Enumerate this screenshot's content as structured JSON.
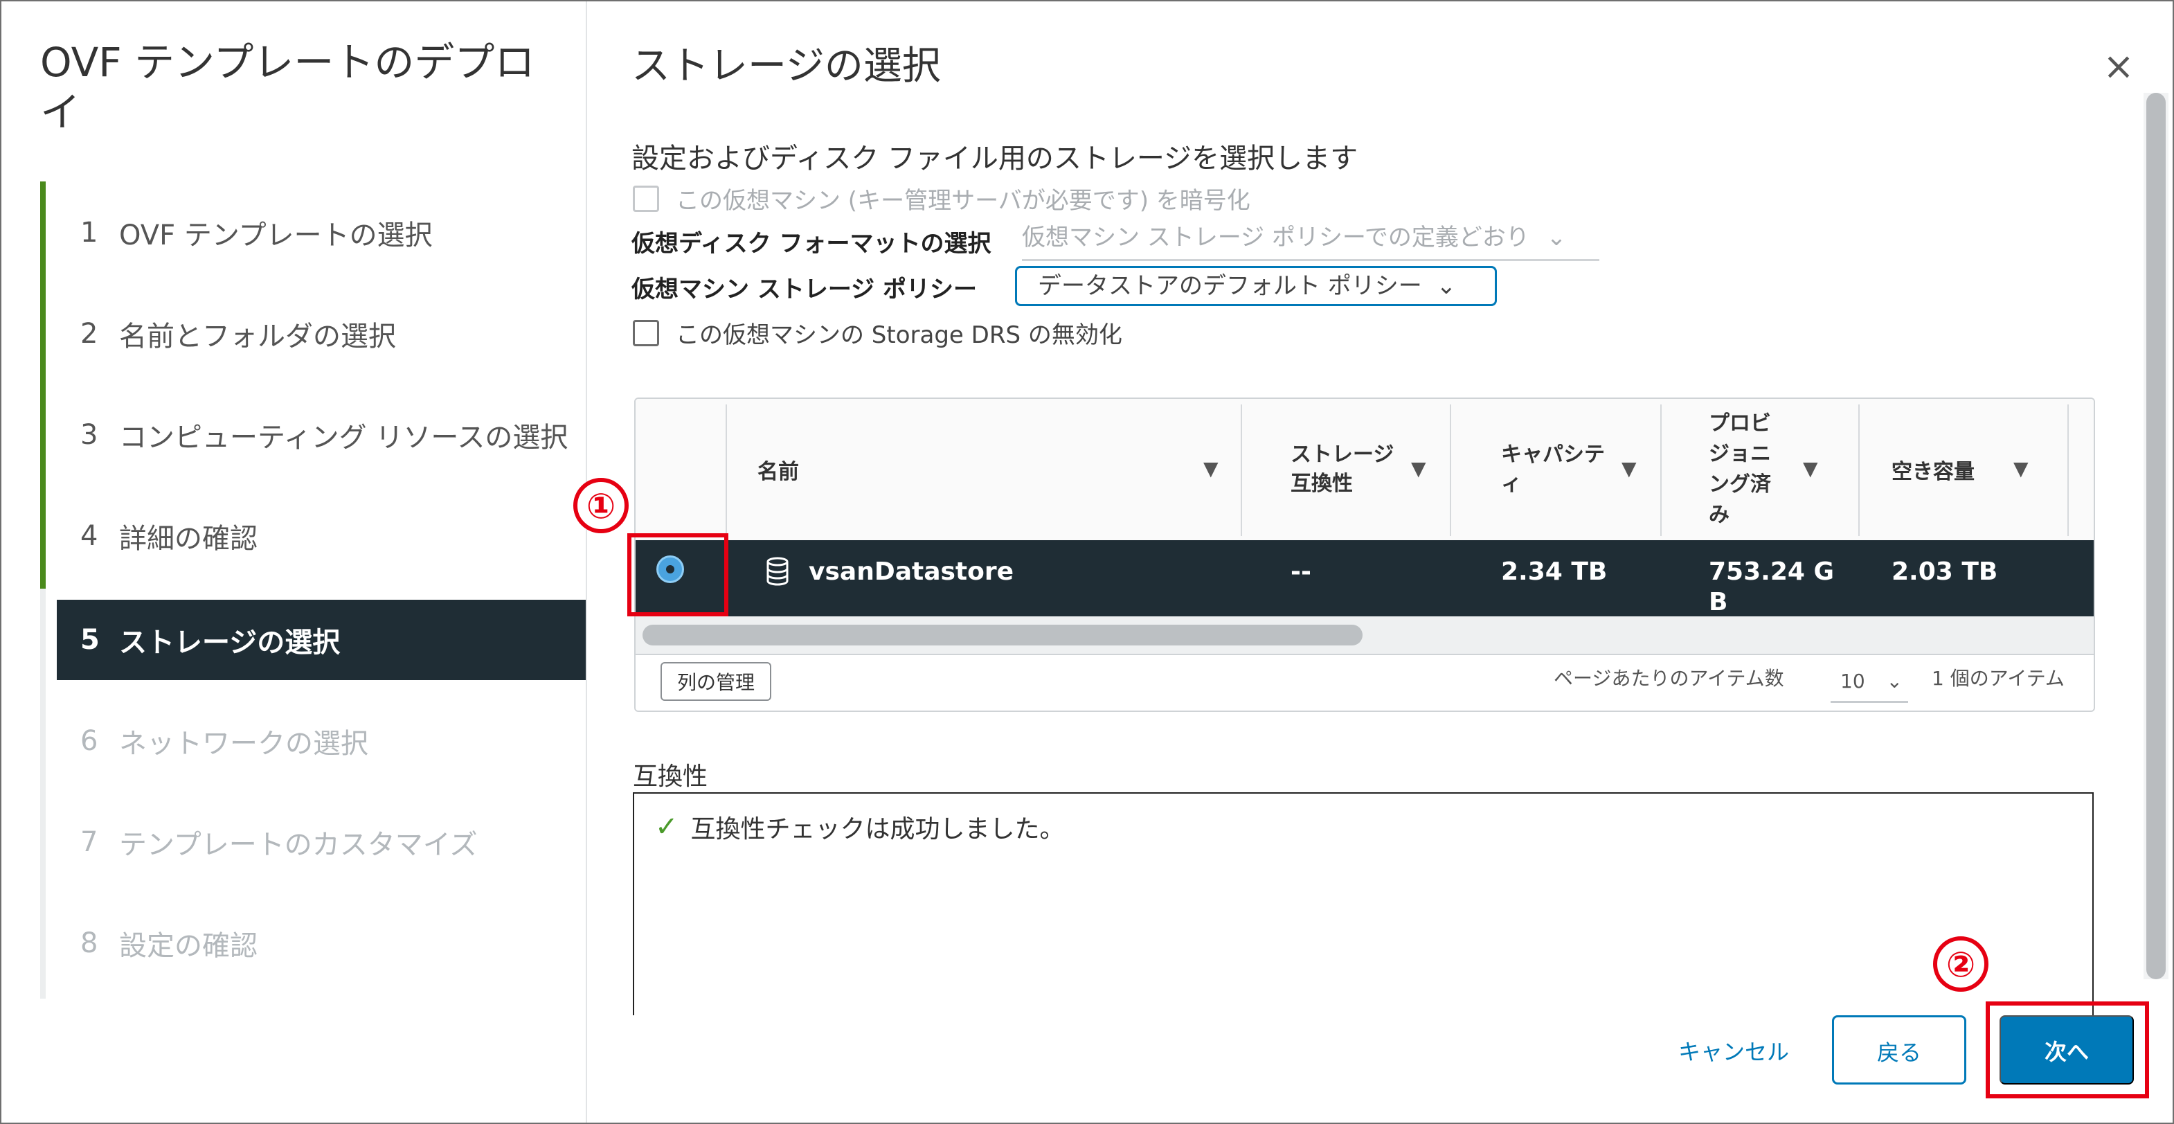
{
  "wizard": {
    "title": "OVF テンプレートのデプロイ",
    "steps": [
      {
        "num": "1",
        "label": "OVF テンプレートの選択"
      },
      {
        "num": "2",
        "label": "名前とフォルダの選択"
      },
      {
        "num": "3",
        "label": "コンピューティング リソースの選択"
      },
      {
        "num": "4",
        "label": "詳細の確認"
      },
      {
        "num": "5",
        "label": "ストレージの選択"
      },
      {
        "num": "6",
        "label": "ネットワークの選択"
      },
      {
        "num": "7",
        "label": "テンプレートのカスタマイズ"
      },
      {
        "num": "8",
        "label": "設定の確認"
      }
    ],
    "active_step": 5
  },
  "main": {
    "title": "ストレージの選択",
    "subtitle": "設定およびディスク ファイル用のストレージを選択します",
    "encrypt_label": "この仮想マシン (キー管理サーバが必要です) を暗号化",
    "disk_format_label": "仮想ディスク フォーマットの選択",
    "disk_format_value": "仮想マシン ストレージ ポリシーでの定義どおり",
    "policy_label": "仮想マシン ストレージ ポリシー",
    "policy_value": "データストアのデフォルト ポリシー",
    "drs_label": "この仮想マシンの Storage DRS の無効化"
  },
  "table": {
    "columns": {
      "name": "名前",
      "compat_l1": "ストレージ",
      "compat_l2": "互換性",
      "capacity_l1": "キャパシテ",
      "capacity_l2": "ィ",
      "prov_l1": "プロビ",
      "prov_l2": "ジョニ",
      "prov_l3": "ング済",
      "prov_l4": "み",
      "free": "空き容量"
    },
    "rows": [
      {
        "name": "vsanDatastore",
        "compat": "--",
        "capacity": "2.34 TB",
        "prov_l1": "753.24 G",
        "prov_l2": "B",
        "free": "2.03 TB"
      }
    ],
    "manage_columns": "列の管理",
    "items_per_page_label": "ページあたりのアイテム数",
    "items_per_page": "10",
    "item_count": "1 個のアイテム"
  },
  "compat": {
    "label": "互換性",
    "message": "互換性チェックは成功しました。"
  },
  "buttons": {
    "cancel": "キャンセル",
    "back": "戻る",
    "next": "次へ"
  },
  "annotations": {
    "one": "①",
    "two": "②"
  },
  "icons": {
    "close": "close-icon",
    "filter": "filter-icon",
    "database": "database-icon",
    "check": "check-icon",
    "chevron": "chevron-down-icon"
  },
  "colors": {
    "accent": "#0079b8",
    "selected_row": "#1f2d35",
    "progress_done": "#4a8a1c",
    "annotation": "#e60012"
  }
}
